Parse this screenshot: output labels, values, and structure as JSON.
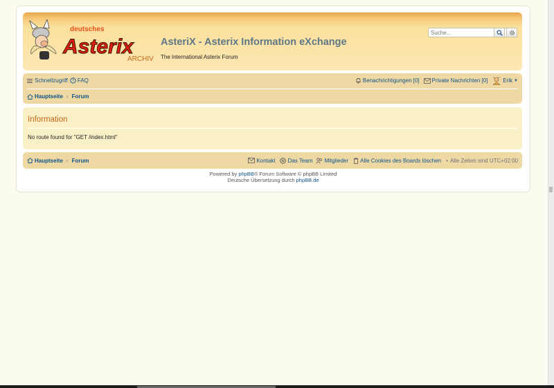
{
  "header": {
    "site_title": "AsteriX - Asterix Information eXchange",
    "site_description": "The International Asterix Forum",
    "logo": {
      "small_text": "deutsches",
      "big_text": "Asterix",
      "tag_text": "ARCHIV"
    },
    "search": {
      "placeholder": "Suche...",
      "search_icon": "search-icon",
      "advanced_icon": "gear-icon"
    }
  },
  "navbar": {
    "quick_links": "Schnellzugriff",
    "faq": "FAQ",
    "notifications": "Benachrichtigungen",
    "notifications_count": "[0]",
    "private_messages": "Private Nachrichten",
    "private_messages_count": "[0]",
    "username": "Erik",
    "breadcrumbs": [
      "Hauptseite",
      "Forum"
    ],
    "breadcrumb_separator": "‹"
  },
  "info_panel": {
    "title": "Information",
    "message": "No route found for \"GET /index.html\""
  },
  "footer_nav": {
    "breadcrumbs": [
      "Hauptseite",
      "Forum"
    ],
    "contact": "Kontakt",
    "team": "Das Team",
    "members": "Mitglieder",
    "delete_cookies": "Alle Cookies des Boards löschen",
    "timezone": "Alle Zeiten sind UTC+02:00",
    "bullet": "•"
  },
  "copyright": {
    "powered_prefix": "Powered by",
    "phpbb": "phpBB",
    "powered_suffix": "® Forum Software © phpBB Limited",
    "translation_prefix": "Deutsche Übersetzung durch",
    "translation_link": "phpBB.de"
  },
  "colors": {
    "link": "#105289",
    "title_orange": "#c26917",
    "navbar_bg": "#eed9a5",
    "panel_bg": "#faf0c8"
  }
}
